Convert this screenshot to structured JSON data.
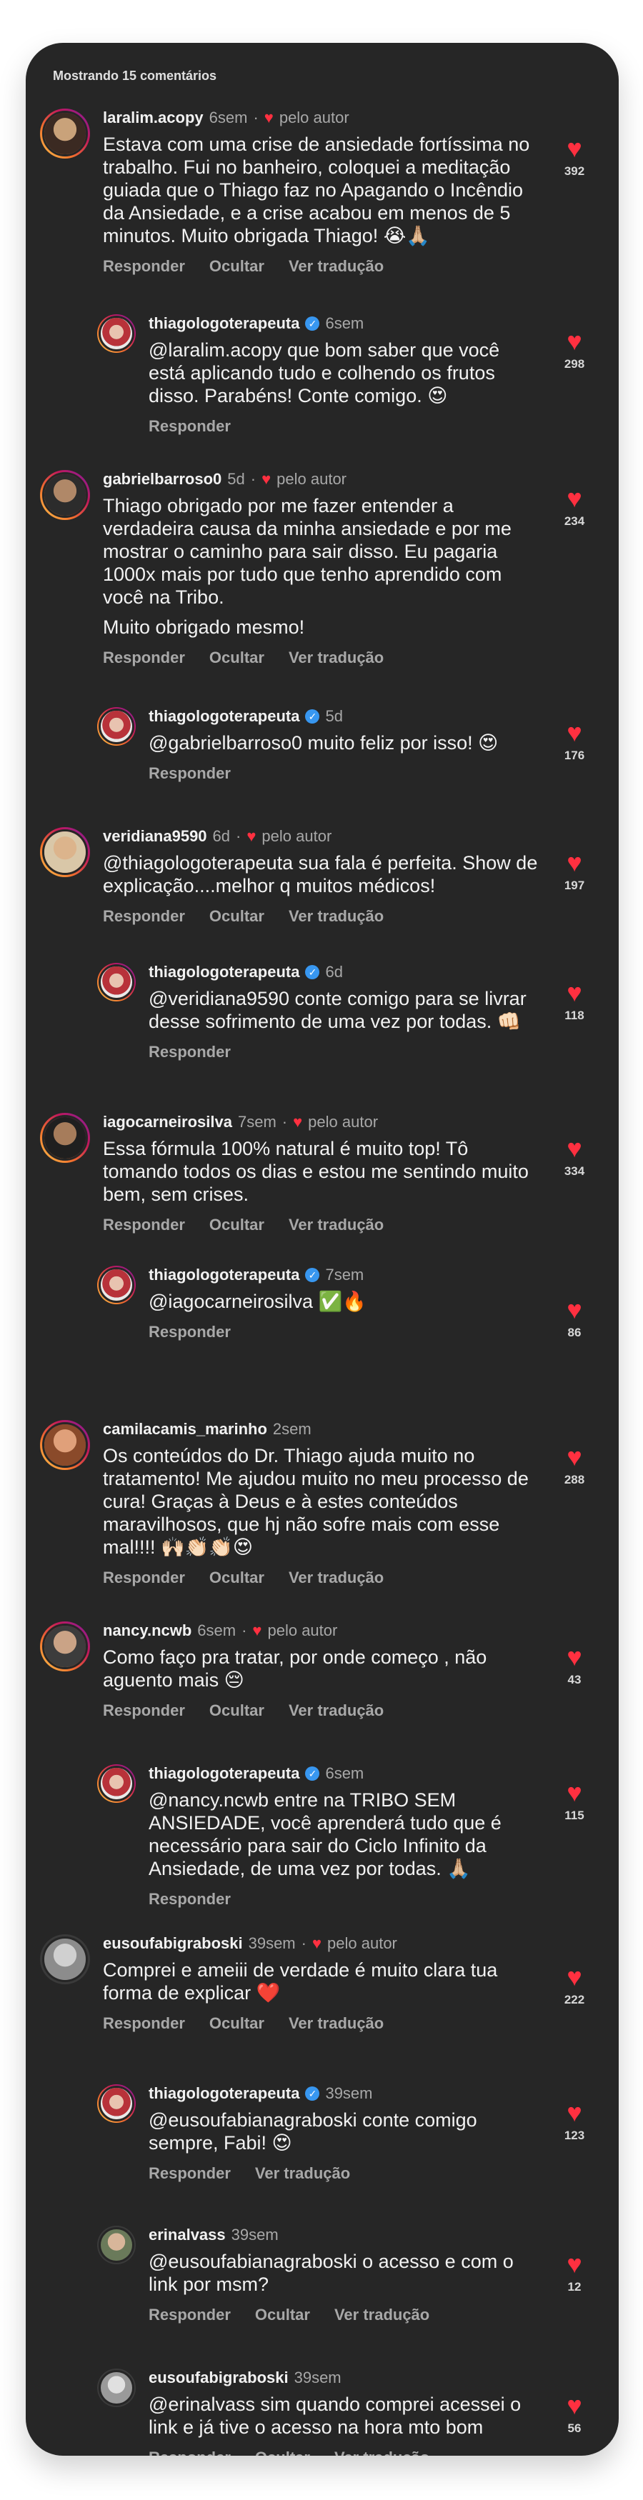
{
  "header": {
    "title": "Mostrando 15 comentários"
  },
  "icons": {
    "liked": "heart-icon",
    "verified": "verified-badge-icon"
  },
  "colors": {
    "panel_bg": "#262626",
    "heart": "#ff3040",
    "verified": "#3897f0",
    "muted": "#a8a8a8"
  },
  "actions": {
    "reply": "Responder",
    "hide": "Ocultar",
    "translate": "Ver tradução"
  },
  "comments": [
    {
      "username": "laralim.acopy",
      "time": "6sem",
      "author_like": "pelo autor",
      "text": [
        "Estava com uma crise de ansiedade fortíssima no trabalho. Fui no banheiro, coloquei a meditação guiada que o Thiago faz no Apagando o Incêndio da Ansiedade, e a crise acabou em menos de 5 minutos. Muito obrigada Thiago! 😭🙏🏼"
      ],
      "likes": "392"
    },
    {
      "username": "thiagologoterapeuta",
      "time": "6sem",
      "text": [
        "@laralim.acopy que bom saber que você está aplicando tudo e colhendo os frutos disso. Parabéns! Conte comigo. 😍"
      ],
      "likes": "298"
    },
    {
      "username": "gabrielbarroso0",
      "time": "5d",
      "author_like": "pelo autor",
      "text": [
        "Thiago obrigado por me fazer entender a verdadeira causa da minha ansiedade e por me mostrar o caminho para sair disso. Eu pagaria 1000x mais por tudo que tenho aprendido com você na Tribo.",
        "Muito obrigado mesmo!"
      ],
      "likes": "234"
    },
    {
      "username": "thiagologoterapeuta",
      "time": "5d",
      "text": [
        "@gabrielbarroso0 muito feliz por isso! 😍"
      ],
      "likes": "176"
    },
    {
      "username": "veridiana9590",
      "time": "6d",
      "author_like": "pelo autor",
      "text": [
        "@thiagologoterapeuta sua fala é perfeita. Show de explicação....melhor q muitos médicos!"
      ],
      "likes": "197"
    },
    {
      "username": "thiagologoterapeuta",
      "time": "6d",
      "text": [
        "@veridiana9590 conte comigo para se livrar desse sofrimento de uma vez por todas. 👊🏻"
      ],
      "likes": "118"
    },
    {
      "username": "iagocarneirosilva",
      "time": "7sem",
      "author_like": "pelo autor",
      "text": [
        "Essa fórmula 100% natural é muito top! Tô tomando todos os dias e estou me sentindo muito bem, sem crises."
      ],
      "likes": "334"
    },
    {
      "username": "thiagologoterapeuta",
      "time": "7sem",
      "text": [
        "@iagocarneirosilva ✅🔥"
      ],
      "likes": "86"
    },
    {
      "username": "camilacamis_marinho",
      "time": "2sem",
      "text": [
        "Os conteúdos do Dr. Thiago ajuda muito no tratamento! Me ajudou muito no meu processo de cura! Graças à Deus e à estes conteúdos maravilhosos, que hj não sofre mais com esse mal!!!! 🙌🏻👏🏻👏🏻😍"
      ],
      "likes": "288"
    },
    {
      "username": "nancy.ncwb",
      "time": "6sem",
      "author_like": "pelo autor",
      "text": [
        "Como faço pra tratar, por onde começo , não aguento mais 😔"
      ],
      "likes": "43"
    },
    {
      "username": "thiagologoterapeuta",
      "time": "6sem",
      "text": [
        "@nancy.ncwb entre na TRIBO SEM ANSIEDADE, você aprenderá tudo que é necessário para sair do Ciclo Infinito da Ansiedade, de uma vez por todas. 🙏🏼"
      ],
      "likes": "115"
    },
    {
      "username": "eusoufabigraboski",
      "time": "39sem",
      "author_like": "pelo autor",
      "text": [
        "Comprei e ameiii de verdade é muito clara tua forma de explicar ❤️"
      ],
      "likes": "222"
    },
    {
      "username": "thiagologoterapeuta",
      "time": "39sem",
      "text": [
        "@eusoufabianagraboski conte comigo sempre, Fabi! 😍"
      ],
      "likes": "123"
    },
    {
      "username": "erinalvass",
      "time": "39sem",
      "text": [
        "@eusoufabianagraboski o acesso e com o link por msm?"
      ],
      "likes": "12"
    },
    {
      "username": "eusoufabigraboski",
      "time": "39sem",
      "text": [
        "@erinalvass sim quando comprei acessei o link e já tive o acesso na hora mto bom"
      ],
      "likes": "56"
    }
  ]
}
